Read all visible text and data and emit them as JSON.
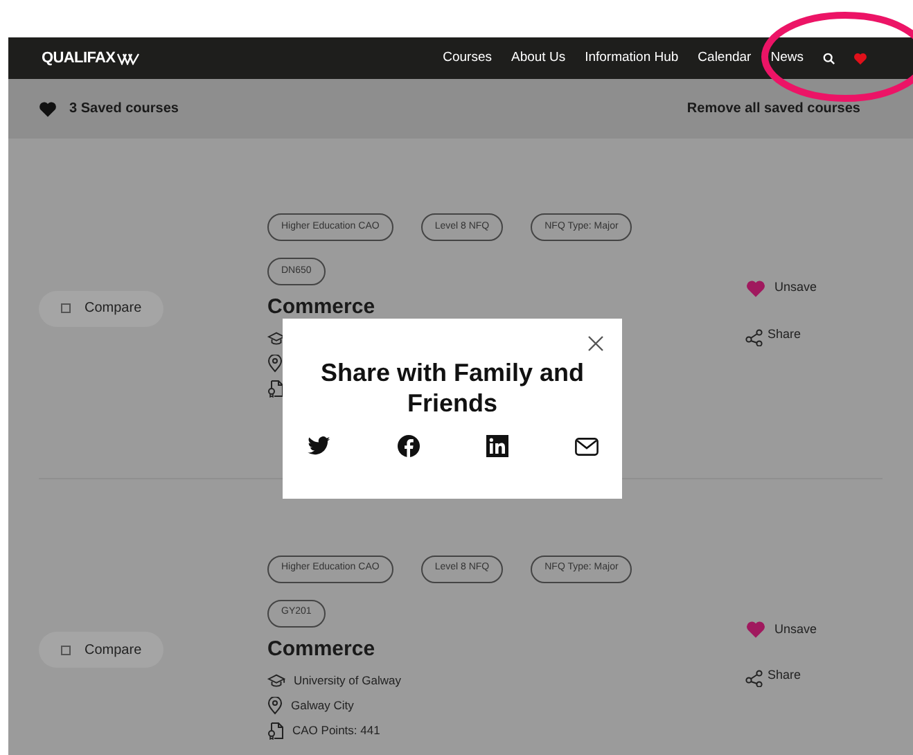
{
  "nav": {
    "logo": "QUALIFAX",
    "links": [
      "Courses",
      "About Us",
      "Information Hub",
      "Calendar",
      "News"
    ]
  },
  "saved_bar": {
    "count_label": "3 Saved courses",
    "remove_label": "Remove all saved courses"
  },
  "courses": [
    {
      "tags": [
        "Higher Education CAO",
        "Level 8 NFQ",
        "NFQ Type: Major",
        "DN650"
      ],
      "compare_label": "Compare",
      "compare_checked": false,
      "title": "Commerce",
      "saved": true,
      "unsave_label": "Unsave",
      "share_label": "Share"
    },
    {
      "tags": [
        "Higher Education CAO",
        "Level 8 NFQ",
        "NFQ Type: Major",
        "GY201"
      ],
      "compare_label": "Compare",
      "compare_checked": false,
      "title": "Commerce",
      "info": [
        {
          "kind": "institution",
          "text": "University of Galway"
        },
        {
          "kind": "location",
          "text": "Galway City"
        },
        {
          "kind": "points",
          "text": "CAO Points: 441"
        }
      ],
      "saved": true,
      "unsave_label": "Unsave",
      "share_label": "Share"
    }
  ],
  "modal": {
    "title": "Share with Family and Friends",
    "buttons": [
      {
        "kind": "twitter"
      },
      {
        "kind": "facebook"
      },
      {
        "kind": "linkedin"
      },
      {
        "kind": "email"
      }
    ]
  }
}
